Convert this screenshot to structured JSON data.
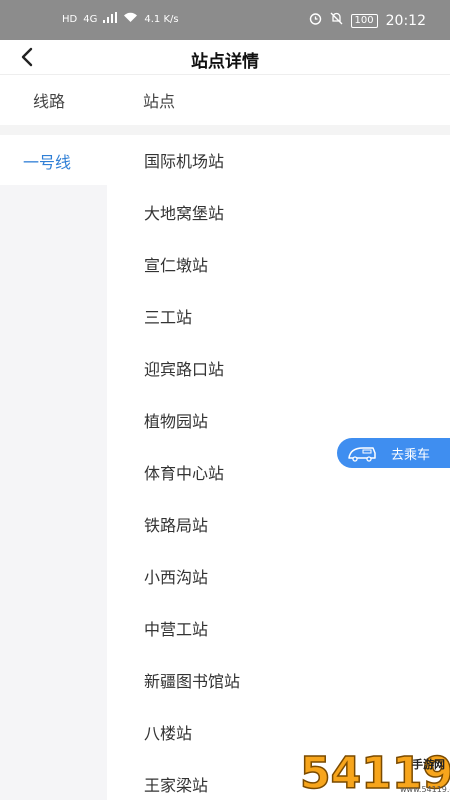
{
  "status_bar": {
    "left_indicators": [
      "HD",
      "4G",
      "4.1 K/s"
    ],
    "time": "20:12",
    "battery": "100",
    "icons": [
      "signal-icon",
      "wifi-icon",
      "alarm-icon",
      "mute-icon",
      "battery-icon"
    ]
  },
  "nav": {
    "title": "站点详情",
    "back_icon": "back-arrow-icon"
  },
  "columns": {
    "line_header": "线路",
    "station_header": "站点"
  },
  "lines": [
    {
      "label": "一号线",
      "active": true
    }
  ],
  "stations": [
    "国际机场站",
    "大地窝堡站",
    "宣仁墩站",
    "三工站",
    "迎宾路口站",
    "植物园站",
    "体育中心站",
    "铁路局站",
    "小西沟站",
    "中营工站",
    "新疆图书馆站",
    "八楼站",
    "王家梁站"
  ],
  "ride_button": {
    "label": "去乘车",
    "icon": "bus-icon"
  },
  "watermark": {
    "text": "54119 手游网",
    "url_text": "www.54119.cn"
  },
  "colors": {
    "accent": "#2f7fd6",
    "button": "#3f8ef0",
    "status_bar": "#8c8c8c",
    "line_panel": "#f5f5f7"
  }
}
